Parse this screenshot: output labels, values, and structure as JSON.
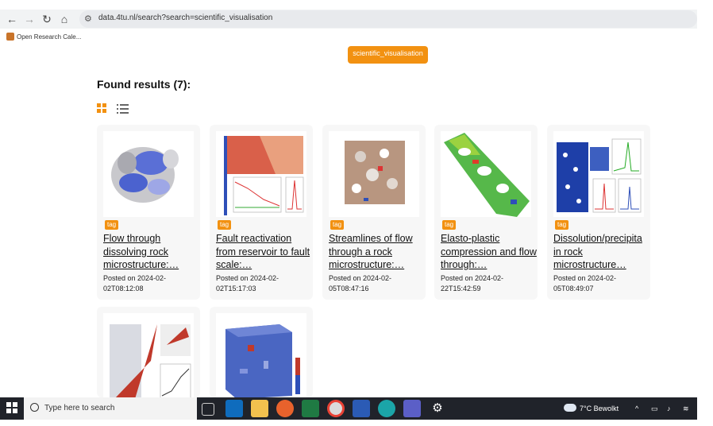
{
  "browser": {
    "url": "data.4tu.nl/search?search=scientific_visualisation",
    "bookmark": "Open Research Cale..."
  },
  "search": {
    "chip_label": "scientific_visualisation"
  },
  "results": {
    "title": "Found results (7):",
    "cards": [
      {
        "tag": "tag",
        "title": "Flow through dissolving rock microstructure:…",
        "date": "Posted on 2024-02-02T08:12:08"
      },
      {
        "tag": "tag",
        "title": "Fault reactivation from reservoir to fault scale:…",
        "date": "Posted on 2024-02-02T15:17:03"
      },
      {
        "tag": "tag",
        "title": "Streamlines of flow through a rock microstructure:…",
        "date": "Posted on 2024-02-05T08:47:16"
      },
      {
        "tag": "tag",
        "title": "Elasto-plastic compression and flow through:…",
        "date": "Posted on 2024-02-22T15:42:59"
      },
      {
        "tag": "tag",
        "title": "Dissolution/precipita in rock microstructure…",
        "date": "Posted on 2024-02-05T08:49:07"
      }
    ]
  },
  "taskbar": {
    "search_placeholder": "Type here to search",
    "weather": "7°C  Bewolkt"
  },
  "colors": {
    "accent": "#f29111",
    "taskbar": "#20232a"
  }
}
